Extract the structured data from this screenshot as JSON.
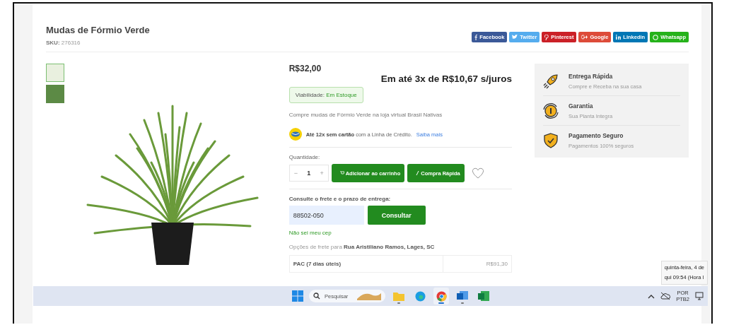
{
  "product": {
    "title": "Mudas de Fórmio Verde",
    "sku_label": "SKU:",
    "sku": "276316"
  },
  "share_buttons": [
    {
      "label": "Facebook",
      "color": "#3b5998",
      "kind": "facebook"
    },
    {
      "label": "Twitter",
      "color": "#55acee",
      "kind": "twitter"
    },
    {
      "label": "Pinterest",
      "color": "#cb2027",
      "kind": "pinterest"
    },
    {
      "label": "Google",
      "color": "#dd4b39",
      "kind": "google"
    },
    {
      "label": "Linkedin",
      "color": "#0077b5",
      "kind": "linkedin"
    },
    {
      "label": "Whatsapp",
      "color": "#25b21a",
      "kind": "whatsapp"
    }
  ],
  "thumbnails": [
    {
      "selected": true
    },
    {
      "selected": false
    }
  ],
  "price": "R$32,00",
  "installments": "Em até 3x de R$10,67 s/juros",
  "availability": {
    "label": "Viabilidade:",
    "value": "Em Estoque"
  },
  "description": "Compre mudas de Fórmio Verde na loja virtual Brasil Nativas",
  "credit": {
    "text": "**Até 12x sem cartão** com a Linha de Crédito.",
    "link": "Saiba mais"
  },
  "quantity": {
    "label": "Quantidade:",
    "minus": "−",
    "value": "1",
    "plus": "+"
  },
  "buttons": {
    "add_to_cart": "Adicionar ao carrinho",
    "quick_buy": "Compra Rápida"
  },
  "shipping": {
    "label": "Consulte o frete e o prazo de entrega:",
    "cep": "88502-050",
    "button": "Consultar",
    "link": "Não sei meu cep",
    "options": "Opções de frete para **Rua Aristiliano Ramos, Lages, SC**",
    "rows": [
      {
        "name": "PAC (7 dias úteis)",
        "price": "R$91,30"
      }
    ]
  },
  "benefits": [
    {
      "kind": "rocket",
      "title": "Entrega Rápida",
      "subtitle": "Compre e Receba na sua casa"
    },
    {
      "kind": "clock",
      "title": "Garantia",
      "subtitle": "Sua Planta Integra"
    },
    {
      "kind": "shield",
      "title": "Pagamento Seguro",
      "subtitle": "Pagamentos 100% seguros"
    }
  ],
  "taskbar": {
    "search_placeholder": "Pesquisar",
    "apps": [
      {
        "kind": "folder",
        "running": true,
        "selected": false
      },
      {
        "kind": "edge",
        "running": false,
        "selected": false
      },
      {
        "kind": "chrome",
        "running": true,
        "selected": true
      },
      {
        "kind": "mail",
        "running": true,
        "selected": false
      },
      {
        "kind": "sheet",
        "running": false,
        "selected": false
      }
    ],
    "language": [
      "POR",
      "PTB2"
    ]
  },
  "tooltip": [
    "quinta-feira, 4 de",
    "qui 09:54 (Hora l"
  ]
}
